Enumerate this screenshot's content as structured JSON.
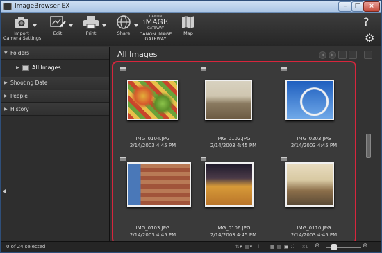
{
  "window": {
    "title": "ImageBrowser EX",
    "min": "–",
    "max": "□",
    "close": "×"
  },
  "toolbar": {
    "import": "Import\nCamera Settings",
    "edit": "Edit",
    "print": "Print",
    "share": "Share",
    "gateway_logo_top": "CANON",
    "gateway_logo_mid": "iMAGE",
    "gateway_logo_bot": "GATEWAY",
    "gateway": "CANON iMAGE\nGATEWAY",
    "map": "Map",
    "help": "?",
    "settings": "⚙"
  },
  "sidebar": {
    "folders": "Folders",
    "all_images": "All Images",
    "shooting_date": "Shooting Date",
    "people": "People",
    "history": "History"
  },
  "content": {
    "title": "All Images",
    "items": [
      {
        "name": "IMG_0104.JPG",
        "date": "2/14/2003 4:45 PM"
      },
      {
        "name": "IMG_0102.JPG",
        "date": "2/14/2003 4:45 PM"
      },
      {
        "name": "IMG_0203.JPG",
        "date": "2/14/2003 4:45 PM"
      },
      {
        "name": "IMG_0103.JPG",
        "date": "2/14/2003 4:45 PM"
      },
      {
        "name": "IMG_0106.JPG",
        "date": "2/14/2003 4:45 PM"
      },
      {
        "name": "IMG_0110.JPG",
        "date": "2/14/2003 4:45 PM"
      }
    ]
  },
  "status": {
    "selected": "0 of 24 selected",
    "zoom_label": "x1",
    "info": "i"
  },
  "colors": {
    "highlight": "#d7263d"
  }
}
